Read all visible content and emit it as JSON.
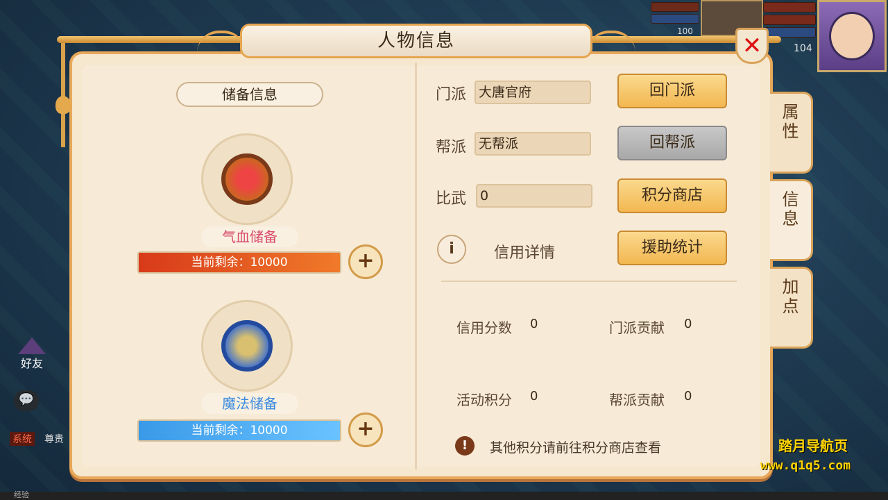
{
  "hud": {
    "pet_level": "100",
    "player_level": "104",
    "friends_label": "好友",
    "system_tag": "系统",
    "system_text": "尊贵",
    "exp_label": "经验"
  },
  "dialog": {
    "title": "人物信息",
    "close_label": "✕"
  },
  "left_panel": {
    "section_title": "储备信息",
    "hp_reserve_label": "气血储备",
    "hp_remaining": "当前剩余：10000",
    "mp_reserve_label": "魔法储备",
    "mp_remaining": "当前剩余：10000",
    "plus_label": "+"
  },
  "right_panel": {
    "sect_label": "门派",
    "sect_value": "大唐官府",
    "return_sect_button": "回门派",
    "gang_label": "帮派",
    "gang_value": "无帮派",
    "return_gang_button": "回帮派",
    "pk_label": "比武",
    "pk_value": "0",
    "points_shop_button": "积分商店",
    "info_icon": "i",
    "credit_detail": "信用详情",
    "assist_stats_button": "援助统计",
    "stats": {
      "credit_score_label": "信用分数",
      "credit_score_value": "0",
      "sect_contribution_label": "门派贡献",
      "sect_contribution_value": "0",
      "activity_points_label": "活动积分",
      "activity_points_value": "0",
      "gang_contribution_label": "帮派贡献",
      "gang_contribution_value": "0"
    },
    "notice_icon": "!",
    "notice_text": "其他积分请前往积分商店查看"
  },
  "tabs": [
    {
      "label": "属\n性"
    },
    {
      "label": "信\n息"
    },
    {
      "label": "加\n点"
    }
  ],
  "watermark": {
    "line1": "踏月导航页",
    "line2": "www.q1q5.com"
  }
}
